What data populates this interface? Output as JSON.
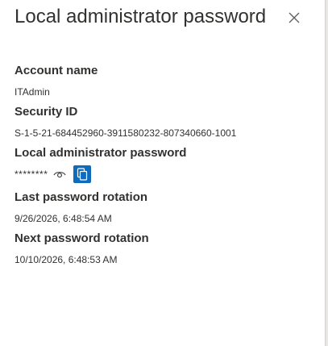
{
  "panel": {
    "title": "Local administrator password",
    "close_icon": "close-icon"
  },
  "fields": {
    "account_name": {
      "label": "Account name",
      "value": "ITAdmin"
    },
    "security_id": {
      "label": "Security ID",
      "value": "S-1-5-21-684452960-3911580232-807340660-1001"
    },
    "local_admin_password": {
      "label": "Local administrator password",
      "masked_value": "********",
      "show_icon": "eye-icon",
      "copy_icon": "copy-icon"
    },
    "last_rotation": {
      "label": "Last password rotation",
      "value": "9/26/2026, 6:48:54 AM"
    },
    "next_rotation": {
      "label": "Next password rotation",
      "value": "10/10/2026, 6:48:53 AM"
    }
  },
  "colors": {
    "accent": "#0f6cbd",
    "text": "#323130"
  }
}
